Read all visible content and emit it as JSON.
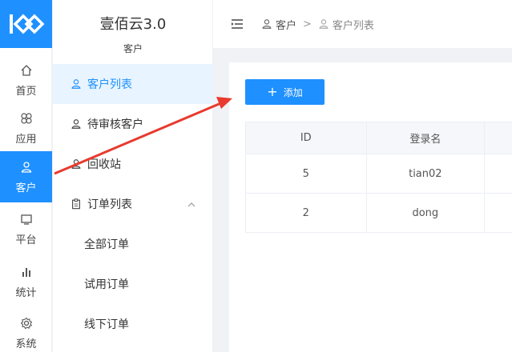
{
  "brand": {
    "title": "壹佰云3.0",
    "subtitle": "客户"
  },
  "rail": [
    {
      "label": "首页",
      "icon": "home-icon"
    },
    {
      "label": "应用",
      "icon": "apps-icon"
    },
    {
      "label": "客户",
      "icon": "user-icon",
      "active": true
    },
    {
      "label": "平台",
      "icon": "monitor-icon"
    },
    {
      "label": "统计",
      "icon": "bar-chart-icon"
    },
    {
      "label": "系统",
      "icon": "gear-icon"
    }
  ],
  "subnav": [
    {
      "label": "客户列表",
      "icon": "user-icon",
      "active": true
    },
    {
      "label": "待审核客户",
      "icon": "user-icon"
    },
    {
      "label": "回收站",
      "icon": "user-icon"
    },
    {
      "label": "订单列表",
      "icon": "clipboard-icon",
      "expanded": true
    },
    {
      "label": "全部订单"
    },
    {
      "label": "试用订单"
    },
    {
      "label": "线下订单"
    }
  ],
  "breadcrumb": {
    "first": "客户",
    "separator": ">",
    "second": "客户列表"
  },
  "toolbar": {
    "add_label": "添加"
  },
  "table": {
    "columns": [
      "ID",
      "登录名"
    ],
    "rows": [
      [
        "5",
        "tian02"
      ],
      [
        "2",
        "dong"
      ]
    ]
  },
  "colors": {
    "accent": "#1e90ff",
    "arrow": "#e83a2e",
    "active_bg": "#e8f4ff"
  }
}
